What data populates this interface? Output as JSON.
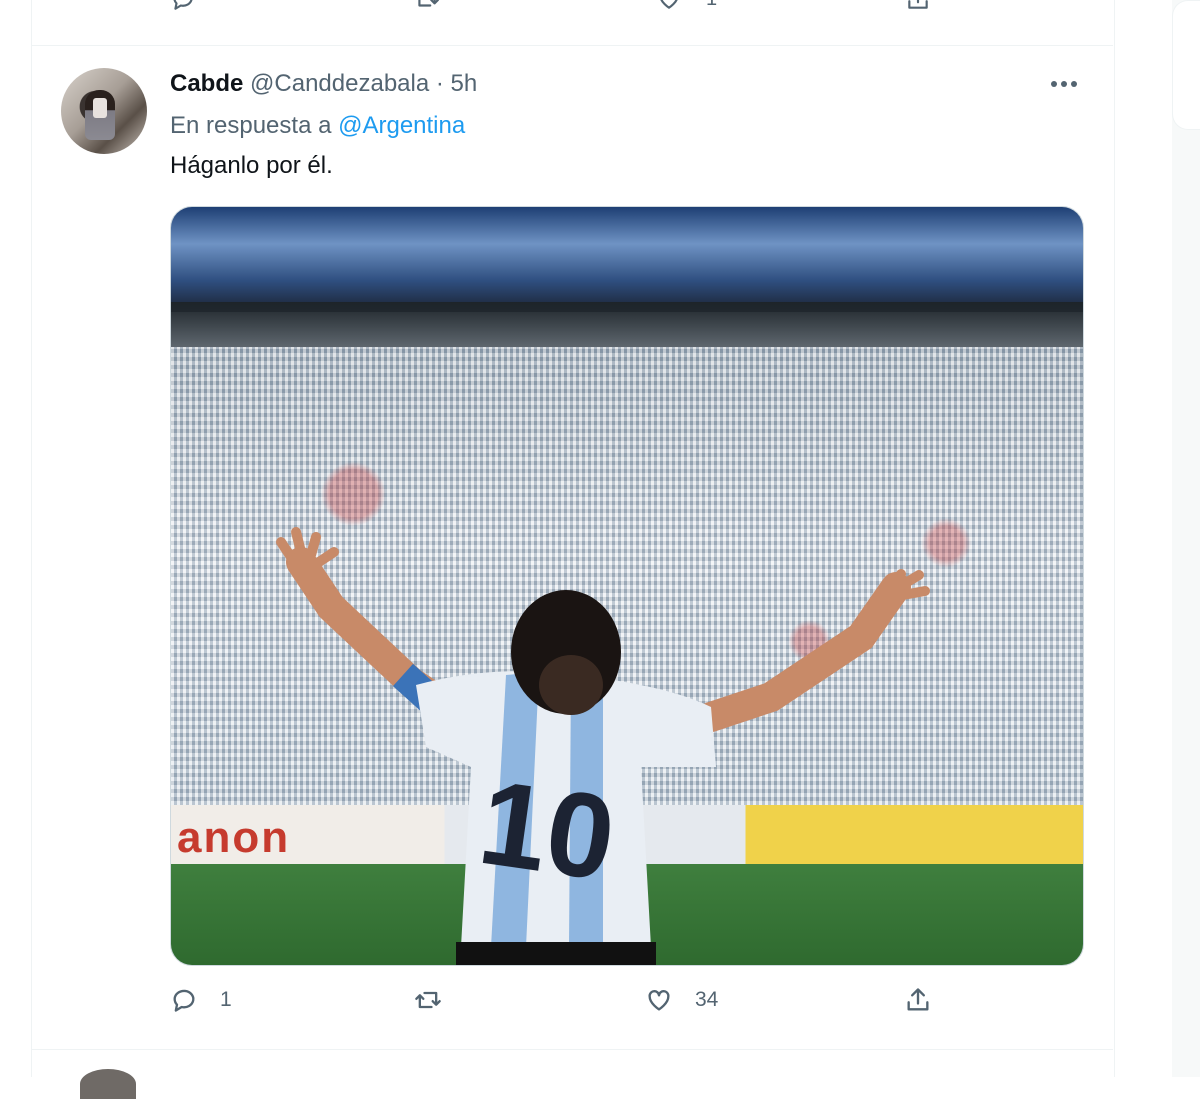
{
  "prev_tweet": {
    "reply_count": "",
    "retweet_count": "",
    "like_count": "1",
    "share_label": ""
  },
  "tweet": {
    "author_name": "Cabde",
    "author_handle": "@Canddezabala",
    "separator": "·",
    "time": "5h",
    "reply_prefix": "En respuesta a",
    "reply_mention": "@Argentina",
    "text": "Háganlo por él.",
    "image_sign_text": "anon",
    "stats": {
      "replies": "1",
      "retweets": "",
      "likes": "34"
    }
  },
  "icons": {
    "reply": "reply-icon",
    "retweet": "retweet-icon",
    "like": "heart-icon",
    "share": "share-icon",
    "more": "more-icon"
  },
  "colors": {
    "link": "#1d9bf0",
    "secondary_text": "#536471",
    "border": "#eff3f4"
  }
}
